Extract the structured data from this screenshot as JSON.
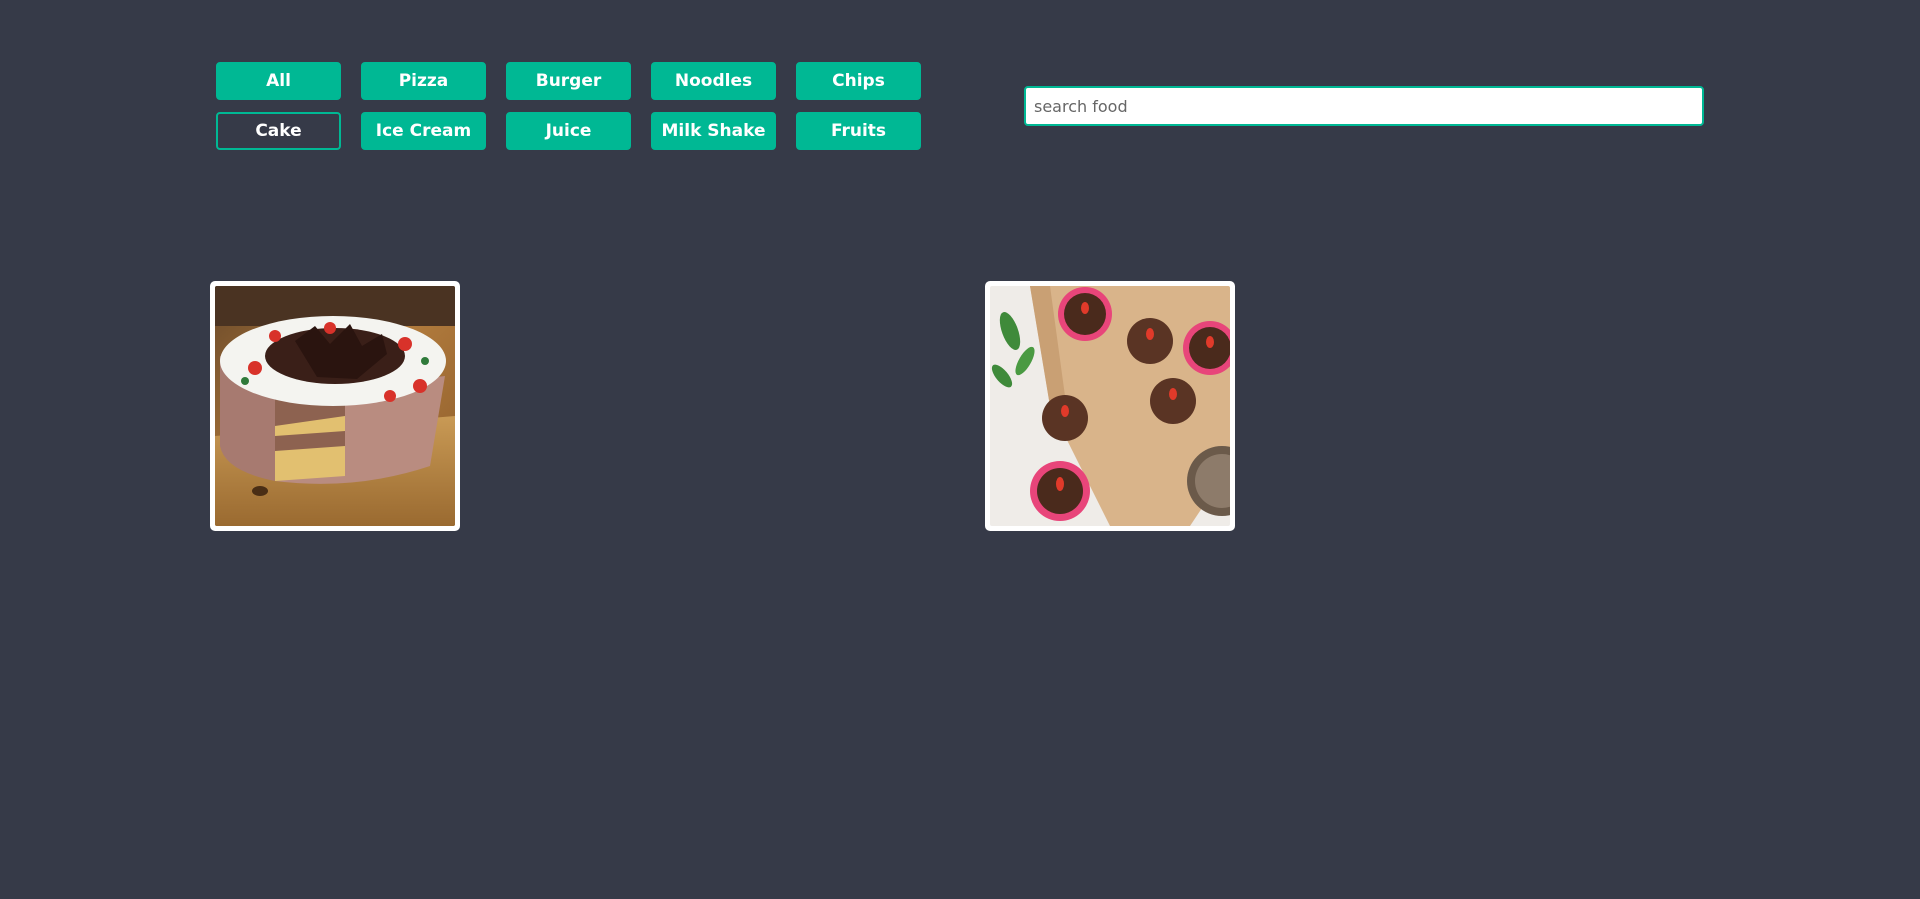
{
  "filters": {
    "items": [
      {
        "label": "All"
      },
      {
        "label": "Pizza"
      },
      {
        "label": "Burger"
      },
      {
        "label": "Noodles"
      },
      {
        "label": "Chips"
      },
      {
        "label": "Cake"
      },
      {
        "label": "Ice Cream"
      },
      {
        "label": "Juice"
      },
      {
        "label": "Milk Shake"
      },
      {
        "label": "Fruits"
      }
    ],
    "active": "Cake"
  },
  "search": {
    "placeholder": "search food",
    "value": ""
  },
  "results": [
    {
      "image": "cake-slice-photo"
    },
    {
      "image": "chocolate-truffles-photo"
    }
  ],
  "colors": {
    "background": "#363a48",
    "accent": "#00b894",
    "button_text": "#ffffff"
  }
}
